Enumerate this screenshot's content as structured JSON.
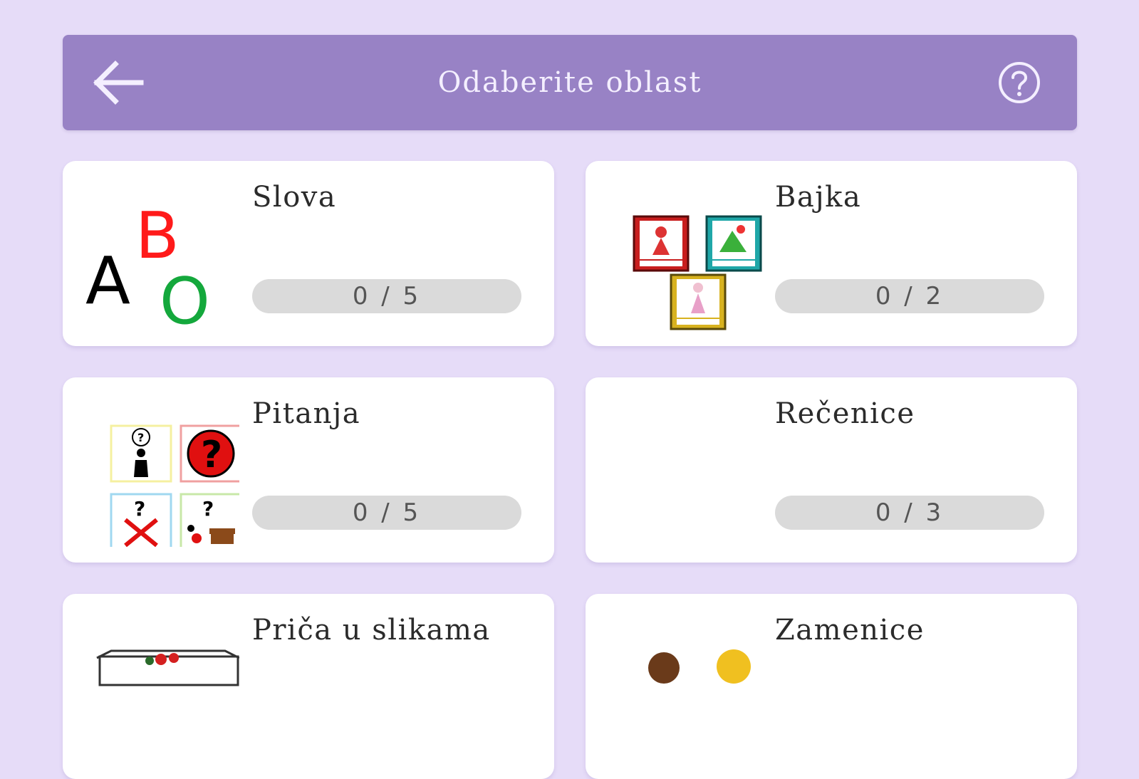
{
  "header": {
    "title": "Odaberite oblast",
    "back_icon": "arrow-left-icon",
    "help_icon": "question-circle-icon",
    "background": "#9882c5"
  },
  "cards": [
    {
      "title": "Slova",
      "progress_text": "0 / 5",
      "progress": 0,
      "icon": "letters-abo-icon",
      "icon_letters": {
        "a": "A",
        "b": "B",
        "o": "O"
      },
      "icon_colors": {
        "a": "#000000",
        "b": "#ff1a1a",
        "o": "#14a83c"
      }
    },
    {
      "title": "Bajka",
      "progress_text": "0 / 2",
      "progress": 0,
      "icon": "fairytale-books-icon"
    },
    {
      "title": "Pitanja",
      "progress_text": "0 / 5",
      "progress": 0,
      "icon": "question-symbols-icon",
      "icon_glyph": "?"
    },
    {
      "title": "Rečenice",
      "progress_text": "0 / 3",
      "progress": 0,
      "icon": ""
    },
    {
      "title": "Priča u slikama",
      "icon": "picture-story-icon"
    },
    {
      "title": "Zamenice",
      "icon": "pronouns-icon"
    }
  ],
  "colors": {
    "page_background": "#e6dcf8",
    "card_background": "#ffffff",
    "progress_track": "#dadada"
  }
}
